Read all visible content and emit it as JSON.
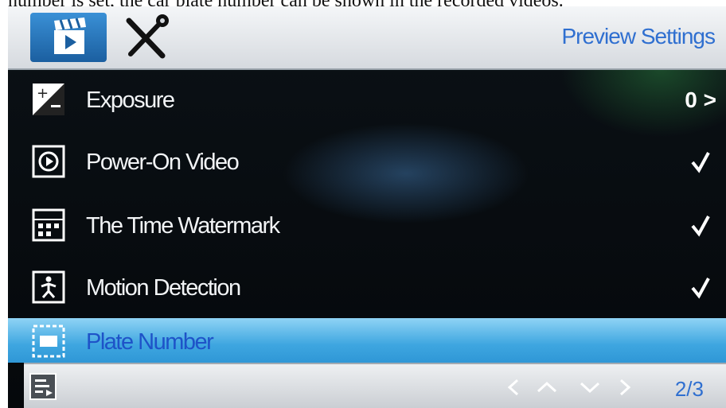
{
  "caption": "number is set, the car plate number can be shown in the recorded videos.",
  "header": {
    "title": "Preview Settings",
    "tabs": [
      {
        "icon": "video-clapper-icon",
        "active": true
      },
      {
        "icon": "tools-icon",
        "active": false
      }
    ]
  },
  "menu": {
    "items": [
      {
        "icon": "exposure-icon",
        "label": "Exposure",
        "value": "0 >"
      },
      {
        "icon": "power-on-video-icon",
        "label": "Power-On Video",
        "checked": true
      },
      {
        "icon": "time-watermark-icon",
        "label": "The Time Watermark",
        "checked": true
      },
      {
        "icon": "motion-detection-icon",
        "label": "Motion Detection",
        "checked": true
      },
      {
        "icon": "plate-number-icon",
        "label": "Plate Number",
        "selected": true
      }
    ]
  },
  "footer": {
    "page": "2/3",
    "nav": [
      "left",
      "up",
      "down",
      "right"
    ]
  },
  "colors": {
    "accent": "#2f6fd0",
    "selected_row": "#3ea6e0",
    "screen_bg": "#05080b"
  }
}
